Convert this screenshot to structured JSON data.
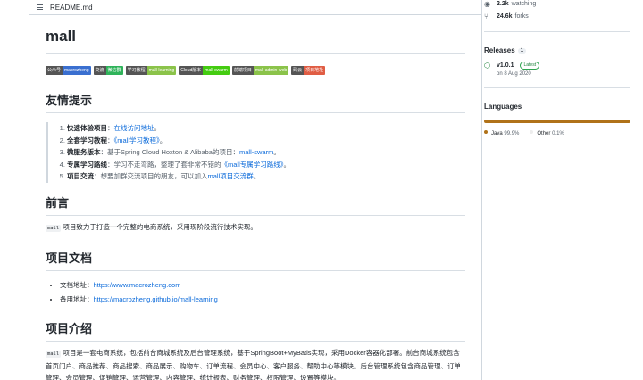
{
  "readme": {
    "filename": "README.md",
    "title": "mall",
    "badges": [
      {
        "left": "公众号",
        "right": "macrozheng",
        "color": "#3a6fd0"
      },
      {
        "left": "交流",
        "right": "微信群",
        "color": "#2fb35a"
      },
      {
        "left": "学习教程",
        "right": "mall-learning",
        "color": "#8bc34a"
      },
      {
        "left": "Cloud版本",
        "right": "mall-swarm",
        "color": "#4c1"
      },
      {
        "left": "前端项目",
        "right": "mall-admin-web",
        "color": "#8bc34a"
      },
      {
        "left": "码云",
        "right": "项目地址",
        "color": "#e05d44"
      }
    ],
    "section_tips": {
      "heading": "友情提示",
      "items": [
        {
          "label": "快速体验项目",
          "text": "：",
          "link": "在线访问地址",
          "after": "。"
        },
        {
          "label": "全套学习教程",
          "text": "：",
          "link": "《mall学习教程》",
          "after": "。"
        },
        {
          "label": "微服务版本",
          "text": "：基于Spring Cloud Hoxton & Alibaba的项目：",
          "link": "mall-swarm",
          "after": "。"
        },
        {
          "label": "专属学习路线",
          "text": "：学习不走弯路，整理了套非常不错的",
          "link": "《mall专属学习路线》",
          "after": "。"
        },
        {
          "label": "项目交流",
          "text": "：想要加群交流项目的朋友，可以加入",
          "link": "mall项目交流群",
          "after": "。"
        }
      ]
    },
    "section_intro": {
      "heading": "前言",
      "code": "mall",
      "text": "项目致力于打造一个完整的电商系统，采用现阶段流行技术实现。"
    },
    "section_docs": {
      "heading": "项目文档",
      "items": [
        {
          "label": "文档地址：",
          "link": "https://www.macrozheng.com"
        },
        {
          "label": "备用地址：",
          "link": "https://macrozheng.github.io/mall-learning"
        }
      ]
    },
    "section_about": {
      "heading": "项目介绍",
      "code": "mall",
      "text": "项目是一套电商系统，包括前台商城系统及后台管理系统，基于SpringBoot+MyBatis实现，采用Docker容器化部署。前台商城系统包含首页门户、商品推荐、商品搜索、商品展示、购物车、订单流程、会员中心、客户服务、帮助中心等模块。后台管理系统包含商品管理、订单管理、会员管理、促销管理、运营管理、内容管理、统计报表、财务管理、权限管理、设置等模块。"
    }
  },
  "sidebar": {
    "watching_count": "2.2k",
    "watching_label": "watching",
    "forks_count": "24.6k",
    "forks_label": "forks",
    "releases_title": "Releases",
    "releases_count": "1",
    "release_version": "v1.0.1",
    "release_badge": "Latest",
    "release_date": "on 8 Aug 2020",
    "languages_title": "Languages",
    "languages": [
      {
        "name": "Java",
        "percent": "99.9%",
        "value": 99.9,
        "color": "#b07219"
      },
      {
        "name": "Other",
        "percent": "0.1%",
        "value": 0.1,
        "color": "#ededed"
      }
    ]
  }
}
